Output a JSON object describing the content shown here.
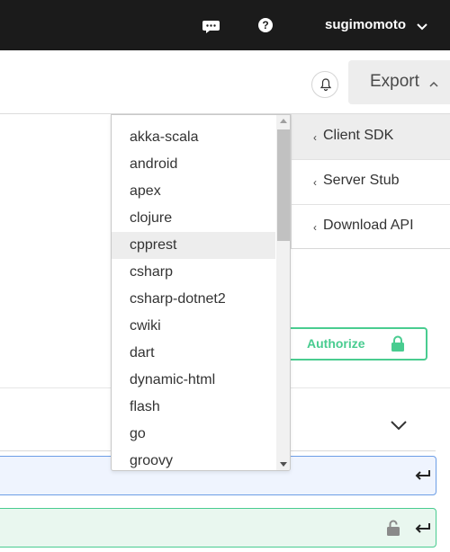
{
  "topbar": {
    "username": "sugimomoto",
    "icons": [
      "chat-icon",
      "help-icon",
      "chevron-down-icon"
    ],
    "help_glyph": "?"
  },
  "header": {
    "export_label": "Export",
    "export_chevron": "chevron-up-icon"
  },
  "export_menu": {
    "items": [
      {
        "label": "Client SDK",
        "chevron": "‹"
      },
      {
        "label": "Server Stub",
        "chevron": "‹"
      },
      {
        "label": "Download API",
        "chevron": "‹"
      }
    ]
  },
  "language_dropdown": {
    "options": [
      "akka-scala",
      "android",
      "apex",
      "clojure",
      "cpprest",
      "csharp",
      "csharp-dotnet2",
      "cwiki",
      "dart",
      "dynamic-html",
      "flash",
      "go",
      "groovy"
    ],
    "hovered": "cpprest"
  },
  "auth": {
    "authorize_label": "Authorize"
  },
  "colors": {
    "topbar": "#1b1b1b",
    "accent_green": "#49cc90",
    "blue_border": "#6d9ee6",
    "blue_bg": "#eff4fe",
    "green_bg": "#e9f7ef"
  }
}
